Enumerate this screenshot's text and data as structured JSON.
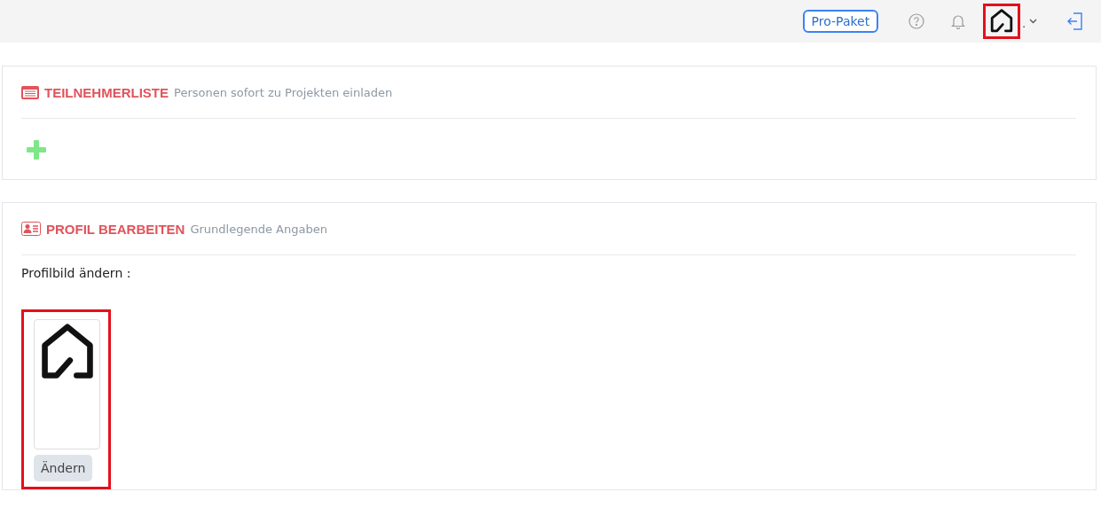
{
  "topbar": {
    "plan_button": "Pro-Paket",
    "user_name": ".",
    "avatar_highlighted": true
  },
  "participants_panel": {
    "title": "TEILNEHMERLISTE",
    "subtitle": "Personen sofort zu Projekten einladen"
  },
  "profile_panel": {
    "title": "PROFIL BEARBEITEN",
    "subtitle": "Grundlegende Angaben",
    "picture_label": "Profilbild ändern :",
    "picture_highlighted": true,
    "change_button": "Ändern"
  }
}
